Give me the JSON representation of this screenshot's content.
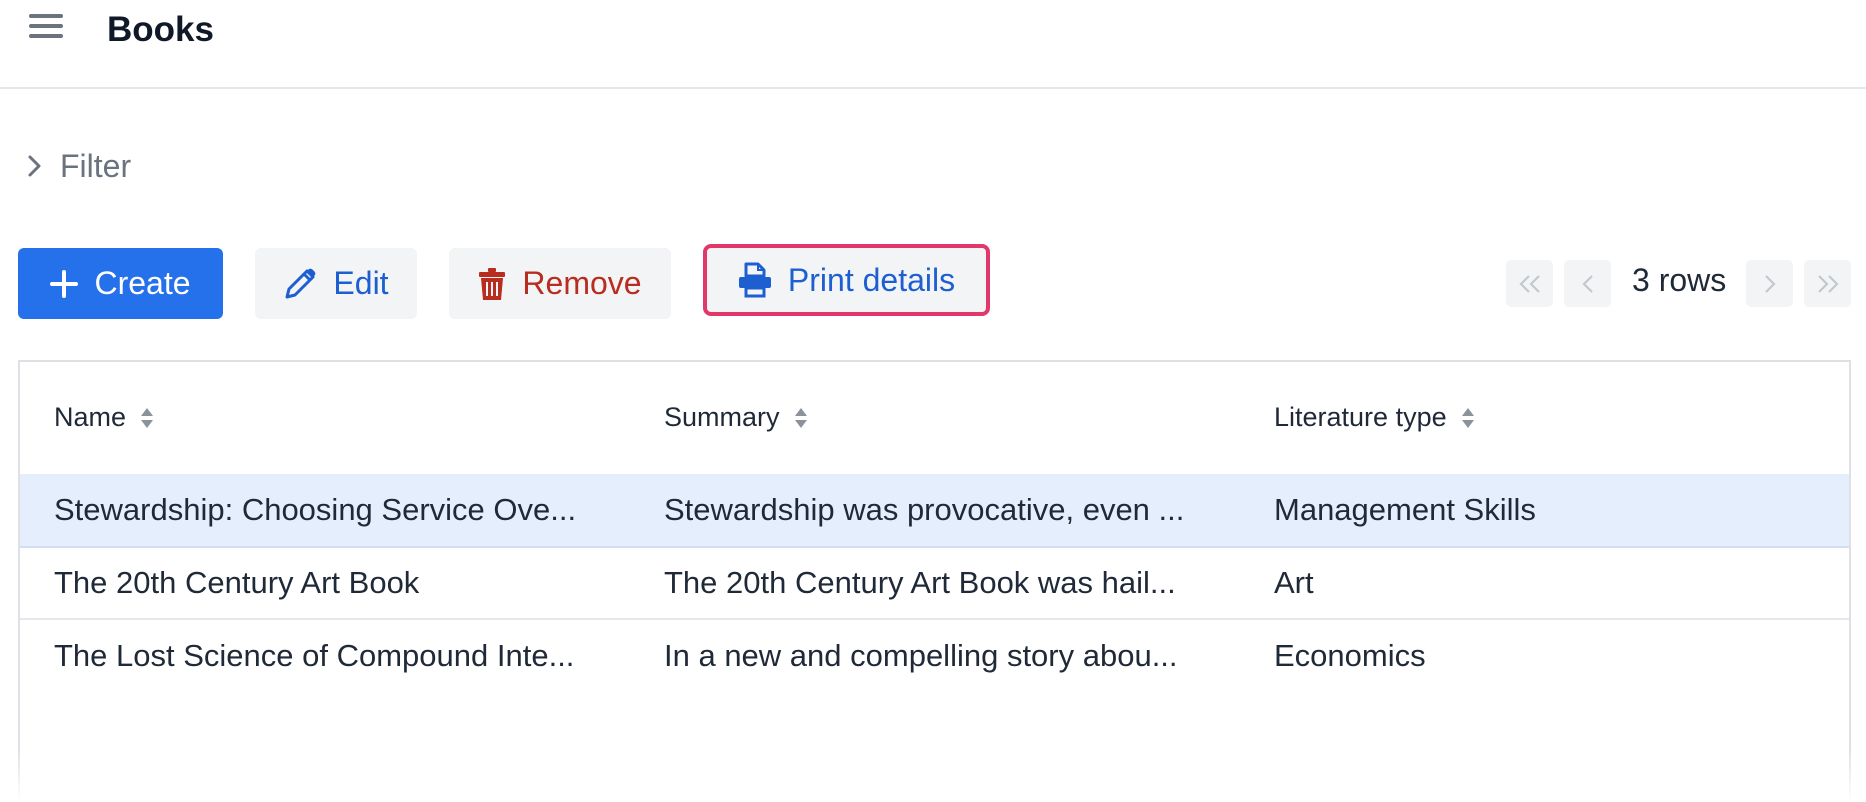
{
  "header": {
    "menu_icon": "hamburger-menu-icon",
    "title": "Books"
  },
  "filter": {
    "icon": "chevron-right-icon",
    "label": "Filter",
    "expanded": false
  },
  "toolbar": {
    "create": {
      "label": "Create",
      "icon": "plus-icon"
    },
    "edit": {
      "label": "Edit",
      "icon": "pencil-icon"
    },
    "remove": {
      "label": "Remove",
      "icon": "trash-icon"
    },
    "print": {
      "label": "Print details",
      "icon": "printer-icon",
      "highlighted": true
    }
  },
  "pagination": {
    "first_icon": "double-chevron-left-icon",
    "prev_icon": "chevron-left-icon",
    "rows_label": "3 rows",
    "next_icon": "chevron-right-icon",
    "last_icon": "double-chevron-right-icon"
  },
  "table": {
    "columns": [
      {
        "label": "Name",
        "sortable": true
      },
      {
        "label": "Summary",
        "sortable": true
      },
      {
        "label": "Literature type",
        "sortable": true
      }
    ],
    "rows": [
      {
        "name": "Stewardship: Choosing Service Ove...",
        "summary": "Stewardship was provocative, even ...",
        "type": "Management Skills",
        "selected": true
      },
      {
        "name": "The 20th Century Art Book",
        "summary": "The 20th Century Art Book was hail...",
        "type": "Art",
        "selected": false
      },
      {
        "name": "The Lost Science of Compound Inte...",
        "summary": "In a new and compelling story abou...",
        "type": "Economics",
        "selected": false
      }
    ]
  },
  "colors": {
    "primary": "#2570eb",
    "link_blue": "#1d5fd1",
    "danger": "#b92c20",
    "highlight_border": "#e2376a",
    "selected_row": "#e4eefd"
  }
}
